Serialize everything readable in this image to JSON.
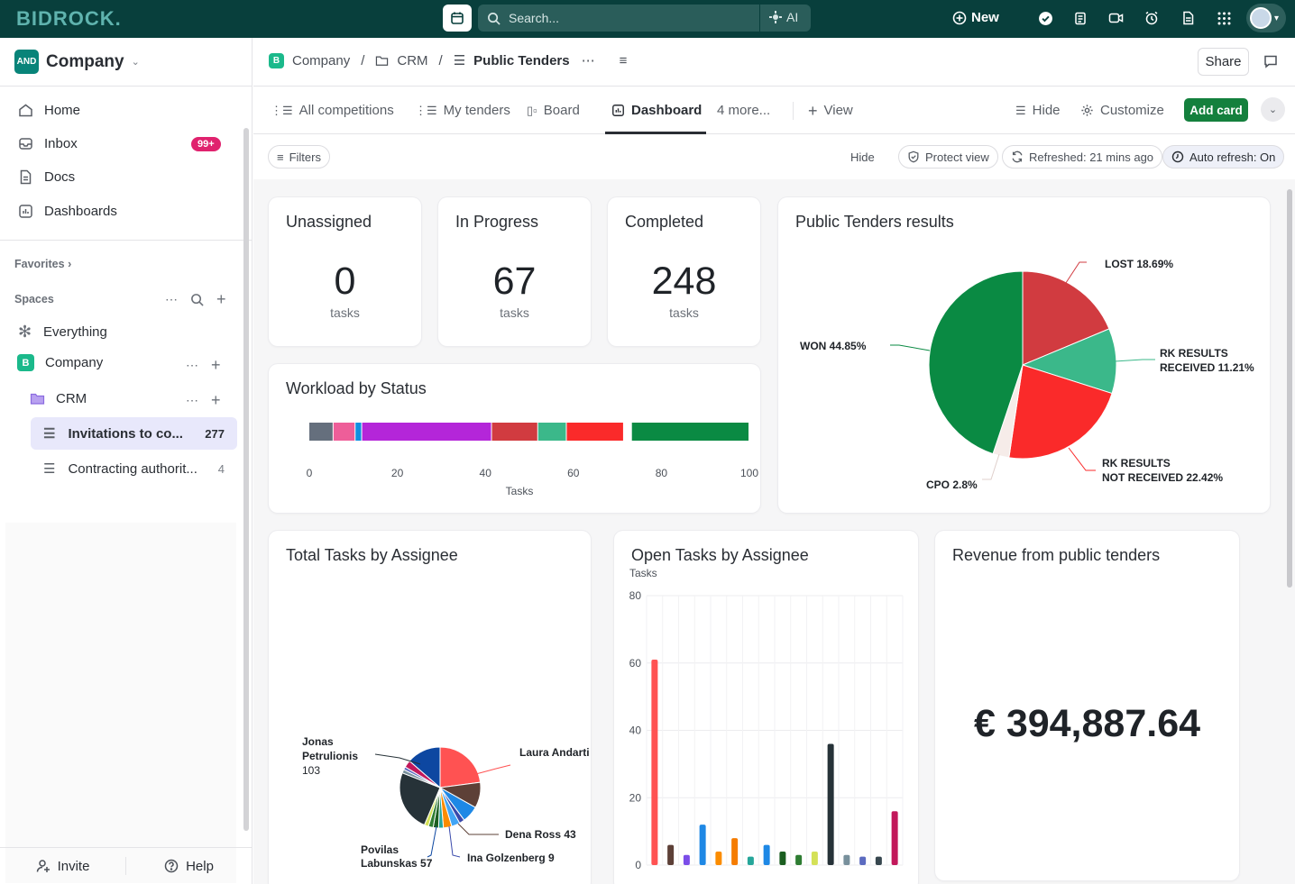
{
  "app": {
    "logo": "BIDROCK.",
    "search_placeholder": "Search...",
    "ai_label": "AI",
    "new_label": "New"
  },
  "sidebar": {
    "workspace_badge": "AND",
    "workspace_name": "Company",
    "nav": [
      {
        "label": "Home",
        "icon": "home-icon"
      },
      {
        "label": "Inbox",
        "icon": "inbox-icon",
        "badge": "99+"
      },
      {
        "label": "Docs",
        "icon": "docs-icon"
      },
      {
        "label": "Dashboards",
        "icon": "dashboards-icon"
      }
    ],
    "favorites_label": "Favorites",
    "spaces_label": "Spaces",
    "everything_label": "Everything",
    "space": {
      "badge": "B",
      "name": "Company"
    },
    "folder": {
      "name": "CRM"
    },
    "lists": [
      {
        "label": "Invitations to co...",
        "count": "277",
        "active": true
      },
      {
        "label": "Contracting authorit...",
        "count": "4",
        "active": false
      }
    ],
    "invite_label": "Invite",
    "help_label": "Help"
  },
  "header": {
    "crumb_space_badge": "B",
    "crumb_space": "Company",
    "crumb_folder": "CRM",
    "crumb_list": "Public Tenders",
    "share_label": "Share"
  },
  "views": {
    "tabs": [
      {
        "label": "All competitions"
      },
      {
        "label": "My tenders"
      },
      {
        "label": "Board"
      },
      {
        "label": "Dashboard",
        "active": true
      },
      {
        "label": "4 more..."
      }
    ],
    "add_view": "View",
    "hide": "Hide",
    "customize": "Customize",
    "add_card": "Add card"
  },
  "filters": {
    "filters_label": "Filters",
    "hide_label": "Hide",
    "protect_label": "Protect view",
    "refreshed_label": "Refreshed: 21 mins ago",
    "auto_refresh_label": "Auto refresh: On"
  },
  "cards": {
    "unassigned": {
      "title": "Unassigned",
      "value": "0",
      "unit": "tasks"
    },
    "in_progress": {
      "title": "In Progress",
      "value": "67",
      "unit": "tasks"
    },
    "completed": {
      "title": "Completed",
      "value": "248",
      "unit": "tasks"
    },
    "pie_title": "Public Tenders results",
    "workload_title": "Workload by Status",
    "assignee_total_title": "Total Tasks by Assignee",
    "assignee_open_title": "Open Tasks by Assignee",
    "revenue_title": "Revenue from public tenders",
    "revenue_value": "€ 394,887.64"
  },
  "chart_data": [
    {
      "type": "pie",
      "title": "Public Tenders results",
      "slices": [
        {
          "label": "LOST",
          "value": 18.69,
          "color": "#d13b40"
        },
        {
          "label": "RK RESULTS RECEIVED",
          "value": 11.21,
          "color": "#3bb88a"
        },
        {
          "label": "RK RESULTS NOT RECEIVED",
          "value": 22.42,
          "color": "#fa2a2a"
        },
        {
          "label": "CPO",
          "value": 2.8,
          "color": "#f6ece9"
        },
        {
          "label": "WON",
          "value": 44.85,
          "color": "#0a8a43"
        }
      ],
      "label_lines": [
        "LOST 18.69%",
        "RK RESULTS",
        "RECEIVED 11.21%",
        "RK RESULTS",
        "NOT RECEIVED 22.42%",
        "CPO 2.8%",
        "WON 44.85%"
      ]
    },
    {
      "type": "bar",
      "title": "Workload by Status",
      "orientation": "horizontal-stacked",
      "xlabel": "Tasks",
      "xlim": [
        0,
        100
      ],
      "ticks": [
        "0",
        "20",
        "40",
        "60",
        "80",
        "100"
      ],
      "segments": [
        {
          "value": 5.5,
          "color": "#656f7d"
        },
        {
          "value": 5,
          "color": "#ee5e99"
        },
        {
          "value": 1.5,
          "color": "#1090e0"
        },
        {
          "value": 29.5,
          "color": "#b426d9"
        },
        {
          "value": 10.5,
          "color": "#d13b40"
        },
        {
          "value": 6.5,
          "color": "#3bb88a"
        },
        {
          "value": 13,
          "color": "#fa2a2a"
        },
        {
          "value": 1.8,
          "color": "#ffffff"
        },
        {
          "value": 26.7,
          "color": "#0a8a43"
        }
      ]
    },
    {
      "type": "pie",
      "title": "Total Tasks by Assignee",
      "slices": [
        {
          "label": "Laura Andarti",
          "value": 96,
          "color": "#ff5252"
        },
        {
          "label": "Dena Ross",
          "value": 43,
          "color": "#5d4037"
        },
        {
          "label": "",
          "value": 28,
          "color": "#1e88e5"
        },
        {
          "label": "Ina Golzenberg",
          "value": 9,
          "color": "#3949ab"
        },
        {
          "label": "",
          "value": 14,
          "color": "#42a5f5"
        },
        {
          "label": "",
          "value": 14,
          "color": "#fb8c00"
        },
        {
          "label": "",
          "value": 8,
          "color": "#26a69a"
        },
        {
          "label": "",
          "value": 9,
          "color": "#1b5e20"
        },
        {
          "label": "",
          "value": 8,
          "color": "#2e7d32"
        },
        {
          "label": "",
          "value": 7,
          "color": "#d4e157"
        },
        {
          "label": "Jonas Petrulionis",
          "value": 103,
          "color": "#263238"
        },
        {
          "label": "",
          "value": 6,
          "color": "#78909c"
        },
        {
          "label": "",
          "value": 5,
          "color": "#5c6bc0"
        },
        {
          "label": "",
          "value": 12,
          "color": "#c2185b"
        },
        {
          "label": "Povilas Labunskas",
          "value": 57,
          "color": "#0d47a1"
        }
      ],
      "label_lines": [
        "Jonas",
        "Petrulionis",
        "103",
        "Laura Andarti",
        "Dena Ross 43",
        "Ina Golzenberg 9",
        "Povilas",
        "Labunskas 57"
      ]
    },
    {
      "type": "bar",
      "title": "Open Tasks by Assignee",
      "ylabel": "Tasks",
      "ylim": [
        0,
        80
      ],
      "ticks": [
        "0",
        "20",
        "40",
        "60",
        "80"
      ],
      "values": [
        61,
        6,
        3,
        12,
        4,
        8,
        2.5,
        6,
        4,
        3,
        4,
        36,
        3,
        2.5,
        2.5,
        16
      ],
      "colors": [
        "#ff5252",
        "#5d4037",
        "#7b4de8",
        "#1e88e5",
        "#fb8c00",
        "#f57c00",
        "#26a69a",
        "#1e88e5",
        "#1b5e20",
        "#2e7d32",
        "#d4e157",
        "#263238",
        "#78909c",
        "#5c6bc0",
        "#37474f",
        "#c2185b"
      ]
    }
  ]
}
